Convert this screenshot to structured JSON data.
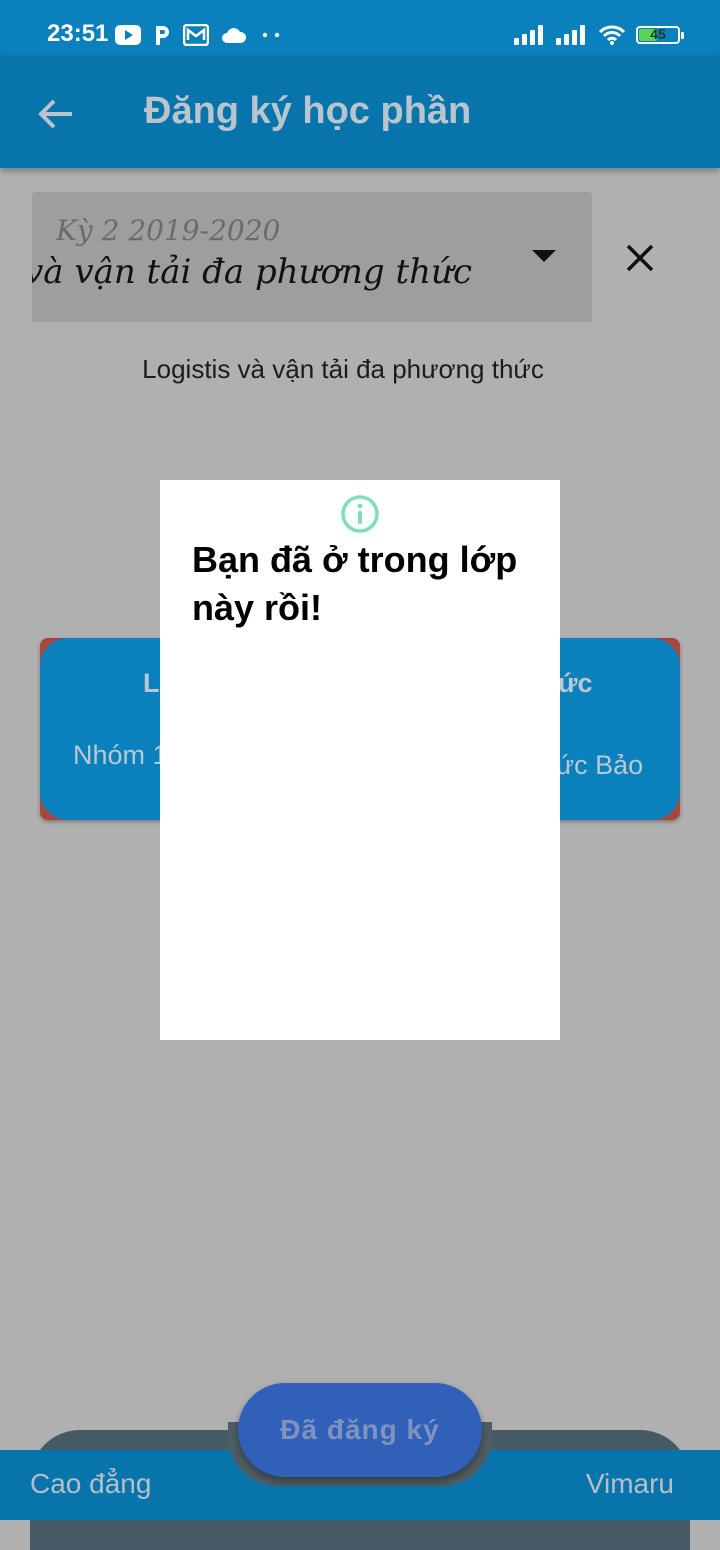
{
  "status_bar": {
    "time": "23:51",
    "battery": "45",
    "icons_left": [
      "youtube-icon",
      "p-app-icon",
      "mail-icon",
      "cloud-icon",
      "more-dots-icon"
    ],
    "icons_right": [
      "signal-icon",
      "signal-icon",
      "wifi-icon",
      "battery-icon"
    ]
  },
  "app_bar": {
    "title": "Đăng ký học phần"
  },
  "dropdown": {
    "label": "Kỳ 2 2019-2020",
    "value": "Logistis và vận tải đa phương thức"
  },
  "subject_text": "Logistis và vận tải đa phương thức",
  "card": {
    "title_left": "Lo",
    "title_right": "ức",
    "sub_left": "Nhóm 1",
    "sub_right": "ức Bảo"
  },
  "fab": {
    "label": "Đã đăng ký"
  },
  "bottom_bar": {
    "left": "Cao đẳng",
    "right": "Vimaru"
  },
  "dialog": {
    "icon": "info-icon",
    "title": "Bạn đã ở trong lớp này rồi!"
  },
  "colors": {
    "primary": "#0774ab",
    "status_bar": "#0a80bd",
    "fab": "#3160b9",
    "info_accent": "#7ee0b4",
    "card_border": "#a9463c"
  }
}
